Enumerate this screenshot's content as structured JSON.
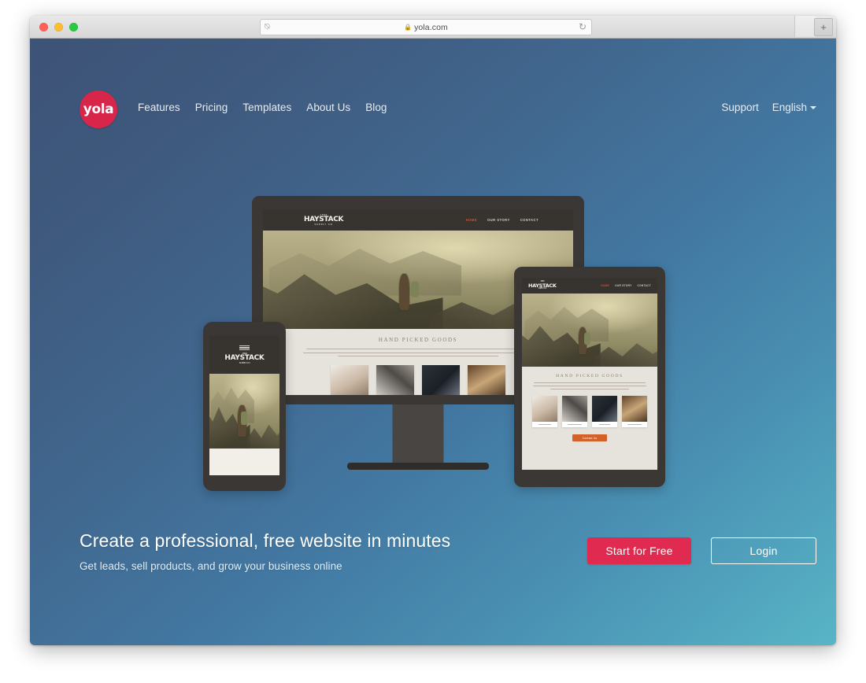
{
  "browser": {
    "traffic_lights": [
      "close",
      "minimize",
      "maximize"
    ],
    "url": "yola.com",
    "lock_icon": "lock-icon",
    "reader_icon": "reader-view-icon",
    "reload_icon": "reload-icon",
    "new_tab_label": "+"
  },
  "site": {
    "logo_text": "yola",
    "logo_color": "#d8254a",
    "nav": [
      {
        "label": "Features"
      },
      {
        "label": "Pricing"
      },
      {
        "label": "Templates"
      },
      {
        "label": "About Us"
      },
      {
        "label": "Blog"
      }
    ],
    "right_nav": {
      "support_label": "Support",
      "language_label": "English"
    },
    "hero": {
      "headline": "Create a professional, free website in minutes",
      "subhead": "Get leads, sell products, and grow your business online",
      "primary_cta": "Start for Free",
      "secondary_cta": "Login",
      "primary_color": "#e02a50"
    },
    "background": {
      "from": "#3d5377",
      "to": "#58b5c6"
    }
  },
  "mockup": {
    "brand": "HAYSTACK",
    "brand_sub": "SUPPLY CO",
    "brand_top": "1899",
    "nav": [
      {
        "label": "HOME",
        "active": true
      },
      {
        "label": "OUR STORY",
        "active": false
      },
      {
        "label": "CONTACT",
        "active": false
      }
    ],
    "section_title": "HAND PICKED GOODS",
    "section_body": "Your home is a three dimensional canvas. Let us help you experiment with the right mix of color, texture and materials from Tomorrow's Journey, our new collection of one-of-a-kind finds from around the globe. Rugged and durable, Tomorrow's Journey is about bringing home a part of the world today.",
    "products": [
      {
        "name": "Shirt"
      },
      {
        "name": "Accessories"
      },
      {
        "name": "Footwear"
      },
      {
        "name": "Accessories"
      }
    ],
    "button_label": "Contact Us",
    "button_color": "#d2622a",
    "accent_color": "#d1502a"
  },
  "devices": [
    {
      "type": "desktop-monitor"
    },
    {
      "type": "tablet"
    },
    {
      "type": "smartphone"
    }
  ]
}
